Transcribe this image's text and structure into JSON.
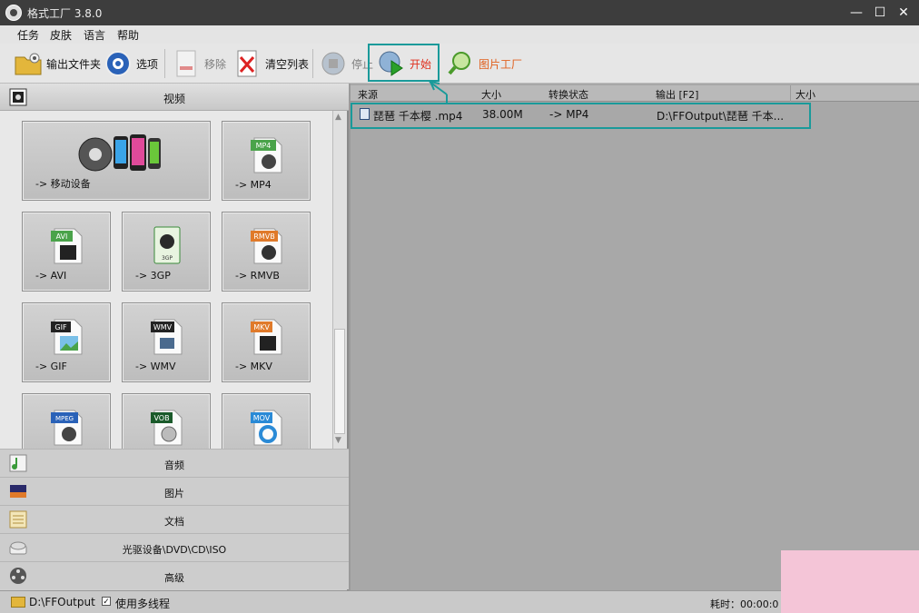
{
  "window": {
    "title": "格式工厂 3.8.0",
    "buttons": [
      "—",
      "☐",
      "✕"
    ]
  },
  "menu": [
    "任务",
    "皮肤",
    "语言",
    "帮助"
  ],
  "toolbar": {
    "output_folder": "输出文件夹",
    "options": "选项",
    "remove": "移除",
    "clear_list": "清空列表",
    "stop": "停止",
    "start": "开始",
    "image_factory": "图片工厂"
  },
  "left": {
    "video_header": "视频",
    "formats": [
      {
        "label": "-> 移动设备"
      },
      {
        "label": "-> MP4",
        "badge": "MP4"
      },
      {
        "label": "-> AVI",
        "badge": "AVI"
      },
      {
        "label": "-> 3GP",
        "badge": "3GP"
      },
      {
        "label": "-> RMVB",
        "badge": "RMVB"
      },
      {
        "label": "-> GIF",
        "badge": "GIF"
      },
      {
        "label": "-> WMV",
        "badge": "WMV"
      },
      {
        "label": "-> MKV",
        "badge": "MKV"
      },
      {
        "label": "",
        "badge": "MPEG"
      },
      {
        "label": "",
        "badge": "VOB"
      },
      {
        "label": "",
        "badge": "MOV"
      }
    ],
    "categories": [
      "音频",
      "图片",
      "文档",
      "光驱设备\\DVD\\CD\\ISO",
      "高级"
    ]
  },
  "list": {
    "columns": [
      "来源",
      "大小",
      "转换状态",
      "输出 [F2]",
      "大小"
    ],
    "rows": [
      {
        "source": "琵琶 千本樱 .mp4",
        "size": "38.00M",
        "status": "-> MP4",
        "output": "D:\\FFOutput\\琵琶 千本..."
      }
    ]
  },
  "status": {
    "folder": "D:\\FFOutput",
    "multithread": "使用多线程",
    "elapsed": "耗时：00:00:0"
  },
  "colors": {
    "highlight": "#1a9a9a",
    "start_label": "#e0301e",
    "image_factory_label": "#e0601e"
  }
}
